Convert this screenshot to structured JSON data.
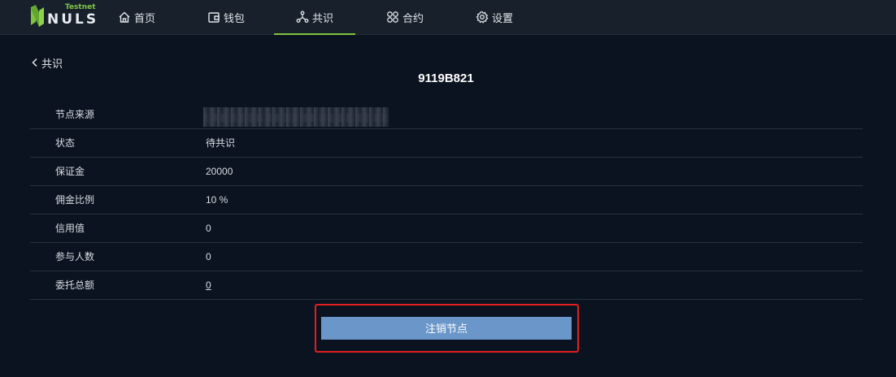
{
  "header": {
    "logo_text": "NULS",
    "logo_badge": "Testnet",
    "nav": [
      {
        "label": "首页",
        "icon": "home-icon"
      },
      {
        "label": "钱包",
        "icon": "wallet-icon"
      },
      {
        "label": "共识",
        "icon": "consensus-icon",
        "active": true
      },
      {
        "label": "合约",
        "icon": "contract-icon"
      },
      {
        "label": "设置",
        "icon": "settings-icon"
      }
    ]
  },
  "back": {
    "label": "共识"
  },
  "node": {
    "title": "9119B821",
    "rows": [
      {
        "label": "节点来源",
        "value": ""
      },
      {
        "label": "状态",
        "value": "待共识"
      },
      {
        "label": "保证金",
        "value": "20000"
      },
      {
        "label": "佣金比例",
        "value": "10 %"
      },
      {
        "label": "信用值",
        "value": "0"
      },
      {
        "label": "参与人数",
        "value": "0"
      },
      {
        "label": "委托总额",
        "value": "0"
      }
    ]
  },
  "actions": {
    "unregister_label": "注销节点"
  },
  "colors": {
    "background": "#0c1320",
    "header": "#18202b",
    "active_tab": "#7fc33f",
    "button": "#6b96c9",
    "highlight": "#e31e1e"
  }
}
